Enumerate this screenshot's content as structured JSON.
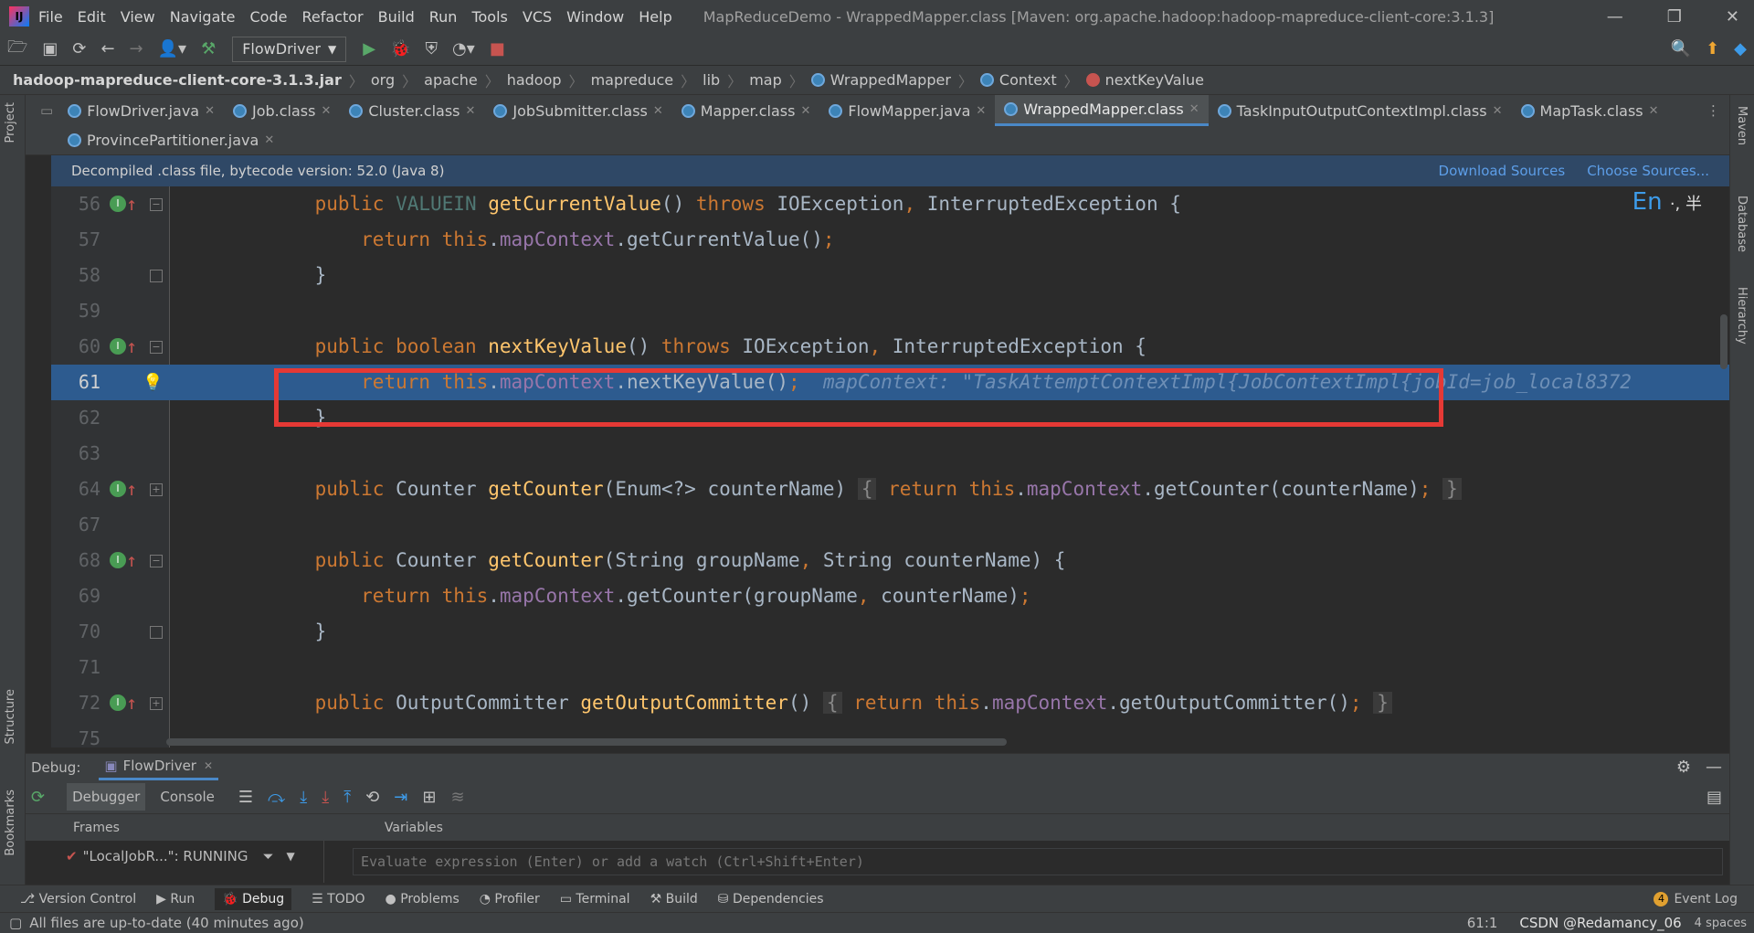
{
  "menu": [
    "File",
    "Edit",
    "View",
    "Navigate",
    "Code",
    "Refactor",
    "Build",
    "Run",
    "Tools",
    "VCS",
    "Window",
    "Help"
  ],
  "window_title": "MapReduceDemo - WrappedMapper.class [Maven: org.apache.hadoop:hadoop-mapreduce-client-core:3.1.3]",
  "toolbar": {
    "run_config": "FlowDriver"
  },
  "breadcrumb": [
    "hadoop-mapreduce-client-core-3.1.3.jar",
    "org",
    "apache",
    "hadoop",
    "mapreduce",
    "lib",
    "map",
    "WrappedMapper",
    "Context",
    "nextKeyValue"
  ],
  "tabs_row1": [
    "FlowDriver.java",
    "Job.class",
    "Cluster.class",
    "JobSubmitter.class",
    "Mapper.class",
    "FlowMapper.java",
    "WrappedMapper.class",
    "TaskInputOutputContextImpl.class",
    "MapTask.class"
  ],
  "tabs_row2": [
    "ProvincePartitioner.java"
  ],
  "active_tab": "WrappedMapper.class",
  "banner": {
    "text": "Decompiled .class file, bytecode version: 52.0 (Java 8)",
    "download": "Download Sources",
    "choose": "Choose Sources..."
  },
  "ime": {
    "lang": "En",
    "extra": "·, 半"
  },
  "lines": [
    {
      "n": "56",
      "t": "    public VALUEIN getCurrentValue() throws IOException, InterruptedException {"
    },
    {
      "n": "57",
      "t": "        return this.mapContext.getCurrentValue();"
    },
    {
      "n": "58",
      "t": "    }"
    },
    {
      "n": "59",
      "t": ""
    },
    {
      "n": "60",
      "t": "    public boolean nextKeyValue() throws IOException, InterruptedException {"
    },
    {
      "n": "61",
      "t": "        return this.mapContext.nextKeyValue();"
    },
    {
      "n": "62",
      "t": "    }"
    },
    {
      "n": "63",
      "t": ""
    },
    {
      "n": "64",
      "t": "    public Counter getCounter(Enum<?> counterName) { return this.mapContext.getCounter(counterName); }"
    },
    {
      "n": "67",
      "t": ""
    },
    {
      "n": "68",
      "t": "    public Counter getCounter(String groupName, String counterName) {"
    },
    {
      "n": "69",
      "t": "        return this.mapContext.getCounter(groupName, counterName);"
    },
    {
      "n": "70",
      "t": "    }"
    },
    {
      "n": "71",
      "t": ""
    },
    {
      "n": "72",
      "t": "    public OutputCommitter getOutputCommitter() { return this.mapContext.getOutputCommitter(); }"
    },
    {
      "n": "75",
      "t": ""
    }
  ],
  "inline_hint": "mapContext: \"TaskAttemptContextImpl{JobContextImpl{jobId=job_local8372",
  "debug": {
    "label": "Debug:",
    "session": "FlowDriver",
    "tab_debugger": "Debugger",
    "tab_console": "Console",
    "frames": "Frames",
    "variables": "Variables",
    "thread": "\"LocalJobR...\": RUNNING",
    "eval_placeholder": "Evaluate expression (Enter) or add a watch (Ctrl+Shift+Enter)"
  },
  "tool_windows": [
    "Version Control",
    "Run",
    "Debug",
    "TODO",
    "Problems",
    "Profiler",
    "Terminal",
    "Build",
    "Dependencies"
  ],
  "event_log": "Event Log",
  "event_count": "4",
  "status": {
    "message": "All files are up-to-date (40 minutes ago)",
    "position": "61:1",
    "watermark": "CSDN @Redamancy_06",
    "indent": "4 spaces"
  },
  "right_stripe": [
    "Maven",
    "Database",
    "Hierarchy"
  ],
  "left_stripe": [
    "Project",
    "Structure",
    "Bookmarks"
  ]
}
